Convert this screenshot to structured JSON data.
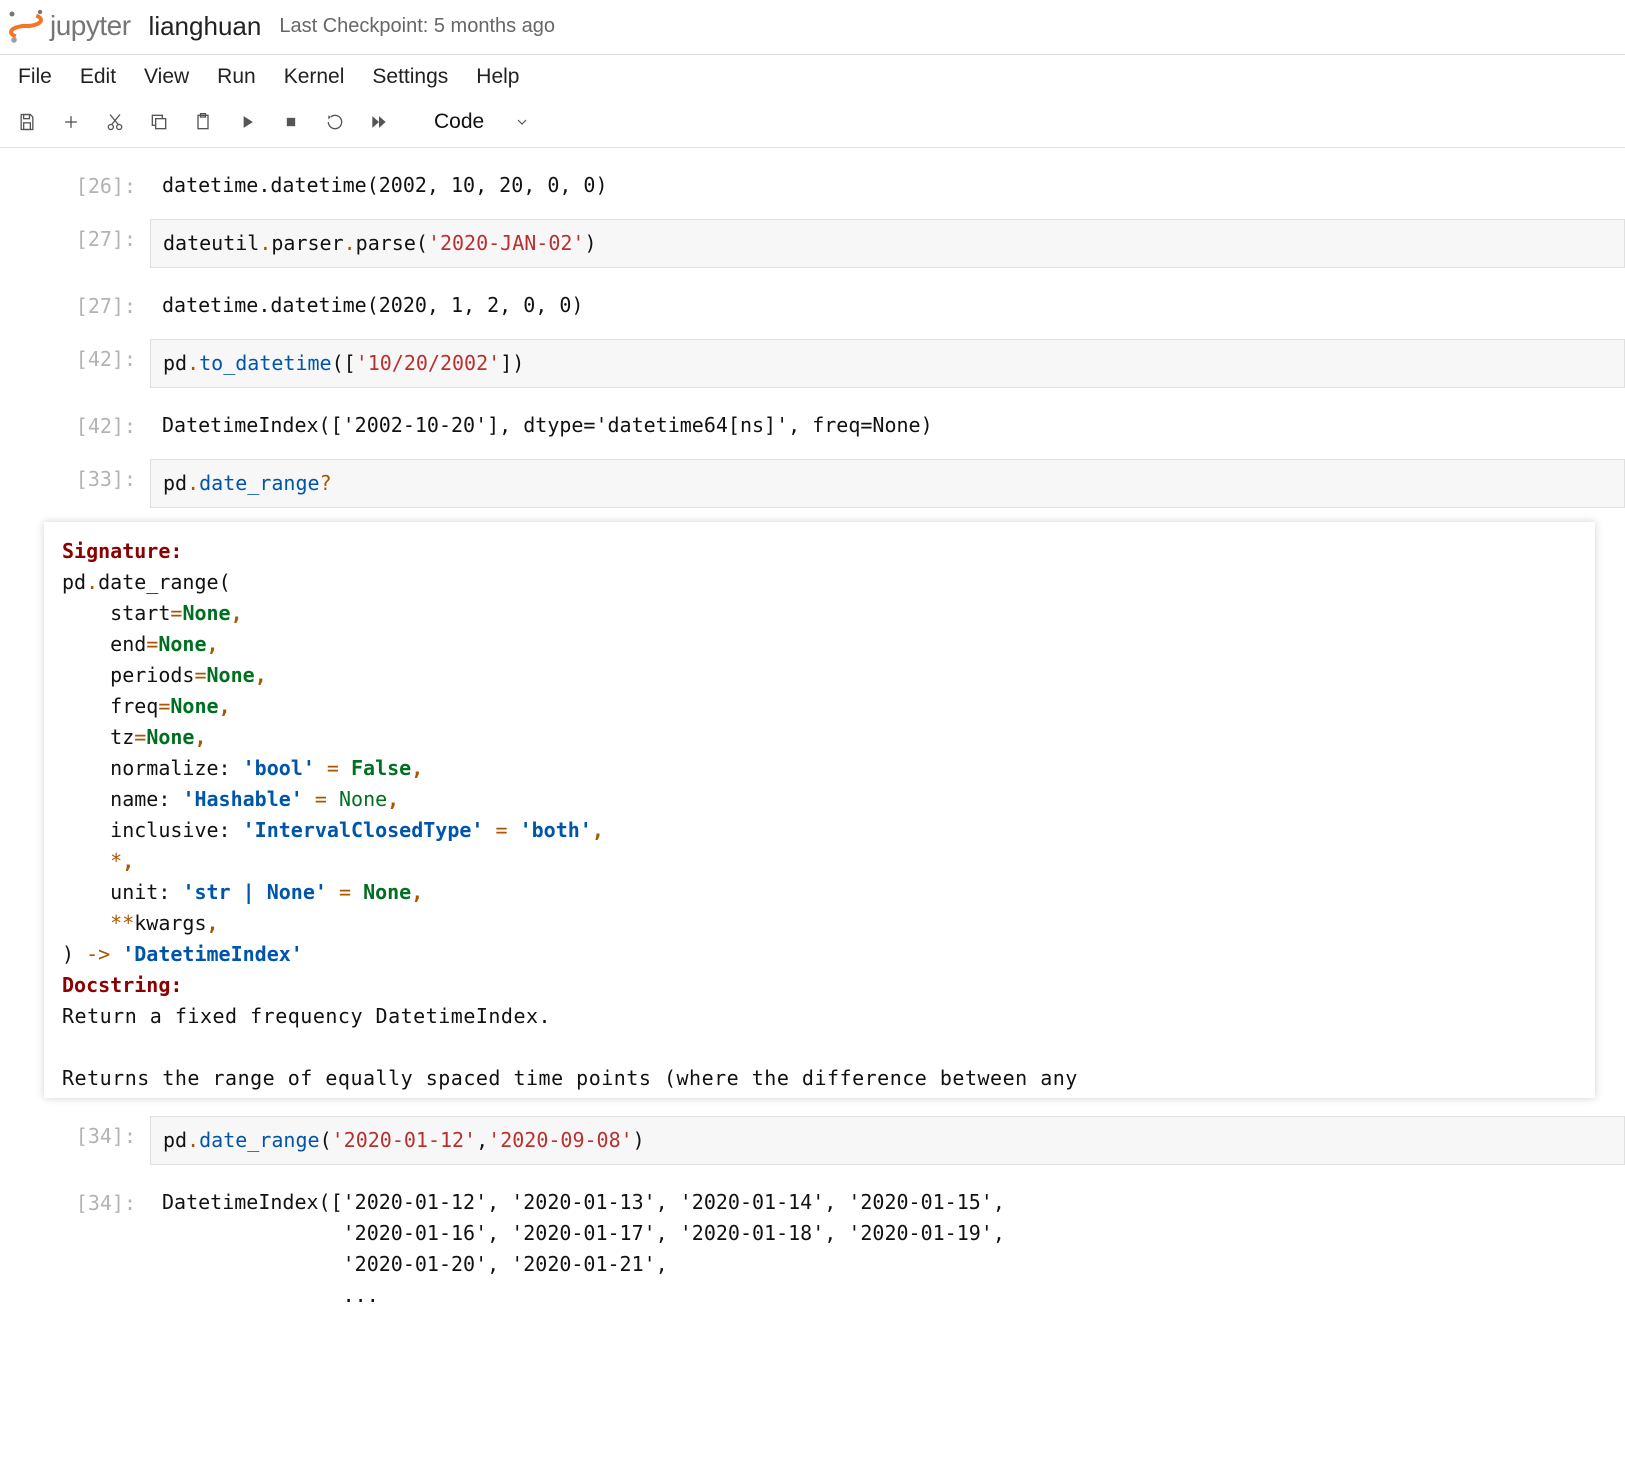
{
  "header": {
    "brand": "jupyter",
    "filename": "lianghuan",
    "checkpoint": "Last Checkpoint: 5 months ago"
  },
  "menu": [
    "File",
    "Edit",
    "View",
    "Run",
    "Kernel",
    "Settings",
    "Help"
  ],
  "toolbar": {
    "cell_type": "Code"
  },
  "cells": {
    "c26_out": {
      "prompt": "[26]:",
      "text": "datetime.datetime(2002, 10, 20, 0, 0)"
    },
    "c27_in": {
      "prompt": "[27]:",
      "pd": "dateutil",
      "dot1": ".",
      "attr1": "parser",
      "dot2": ".",
      "attr2": "parse",
      "open": "(",
      "str": "'2020-JAN-02'",
      "close": ")"
    },
    "c27_out": {
      "prompt": "[27]:",
      "text": "datetime.datetime(2020, 1, 2, 0, 0)"
    },
    "c42_in": {
      "prompt": "[42]:",
      "pd": "pd",
      "dot": ".",
      "attr": "to_datetime",
      "open": "([",
      "str": "'10/20/2002'",
      "close": "])"
    },
    "c42_out": {
      "prompt": "[42]:",
      "text": "DatetimeIndex(['2002-10-20'], dtype='datetime64[ns]', freq=None)"
    },
    "c33_in": {
      "prompt": "[33]:",
      "pd": "pd",
      "dot": ".",
      "attr": "date_range",
      "qm": "?"
    },
    "doc": {
      "sig": "Signature:",
      "l1a": "pd",
      "l1b": ".",
      "l1c": "date_range",
      "l1d": "(",
      "p1a": "start",
      "eq": "=",
      "none": "None",
      "comma": ",",
      "p2a": "end",
      "p3a": "periods",
      "p4a": "freq",
      "p5a": "tz",
      "p6a": "normalize",
      "colon": ": ",
      "p6b": "'bool'",
      "p6c": " = ",
      "false": "False",
      "p7a": "name",
      "p7b": "'Hashable'",
      "p7none": "None",
      "p8a": "inclusive",
      "p8b": "'IntervalClosedType'",
      "p8c": "'both'",
      "star": "*",
      "p9a": "unit",
      "p9b": "'str | None'",
      "p10": "**",
      "p10a": "kwargs",
      "ret1": ")",
      "ret2": " -> ",
      "ret3": "'DatetimeIndex'",
      "dhdr": "Docstring:",
      "d1": "Return a fixed frequency DatetimeIndex.",
      "d2": "Returns the range of equally spaced time points (where the difference between any"
    },
    "c34_in": {
      "prompt": "[34]:",
      "pd": "pd",
      "dot": ".",
      "attr": "date_range",
      "open": "(",
      "str1": "'2020-01-12'",
      "comma": ",",
      "str2": "'2020-09-08'",
      "close": ")"
    },
    "c34_out": {
      "prompt": "[34]:",
      "l1": "DatetimeIndex(['2020-01-12', '2020-01-13', '2020-01-14', '2020-01-15',",
      "l2": "               '2020-01-16', '2020-01-17', '2020-01-18', '2020-01-19',",
      "l3": "               '2020-01-20', '2020-01-21',",
      "l4": "               ..."
    }
  }
}
